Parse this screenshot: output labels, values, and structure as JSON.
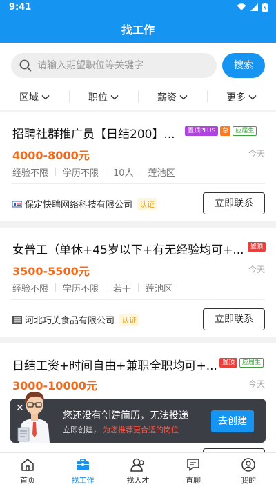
{
  "status": {
    "time": "9:41"
  },
  "header": {
    "title": "找工作"
  },
  "search": {
    "placeholder": "请输入期望职位等关键字",
    "button": "搜索"
  },
  "filters": [
    "区域",
    "职位",
    "薪资",
    "更多"
  ],
  "jobs": [
    {
      "title": "招聘社群推广员【日结200】...",
      "tags": [
        "置顶PLUS",
        "急",
        "应届生"
      ],
      "salary": "4000-8000元",
      "date": "今天",
      "reqs": [
        "经验不限",
        "学历不限",
        "10人",
        "莲池区"
      ],
      "company": "保定快聘网络科技有限公司",
      "verified": "认证",
      "contact": "立即联系"
    },
    {
      "title": "女普工（单休+45岁以下+有无经验均可+...",
      "tags": [
        "置顶"
      ],
      "salary": "3500-5500元",
      "date": "今天",
      "reqs": [
        "经验不限",
        "学历不限",
        "若干",
        "莲池区"
      ],
      "company": "河北巧芙食品有限公司",
      "verified": "认证",
      "contact": "立即联系"
    },
    {
      "title": "日结工资+时间自由+兼职全职均可+...",
      "tags": [
        "置顶",
        "应届生"
      ],
      "salary": "3000-10000元",
      "date": "今天"
    }
  ],
  "popup": {
    "close": "✕",
    "message": "您还没有创建简历，无法投递",
    "sub_prefix": "立即创建，",
    "sub_highlight": "为您推荐更合适的岗位",
    "button": "去创建"
  },
  "tabbar": [
    {
      "label": "首页",
      "icon": "home-icon"
    },
    {
      "label": "找工作",
      "icon": "briefcase-icon",
      "active": true
    },
    {
      "label": "找人才",
      "icon": "people-icon"
    },
    {
      "label": "直聊",
      "icon": "chat-icon"
    },
    {
      "label": "我的",
      "icon": "profile-icon"
    }
  ],
  "colors": {
    "primary": "#1694f2",
    "salary": "#f26b1d",
    "top_tag": "#e8403c",
    "plus_tag": "#b043e0",
    "fresh_tag": "#3aa53a"
  }
}
